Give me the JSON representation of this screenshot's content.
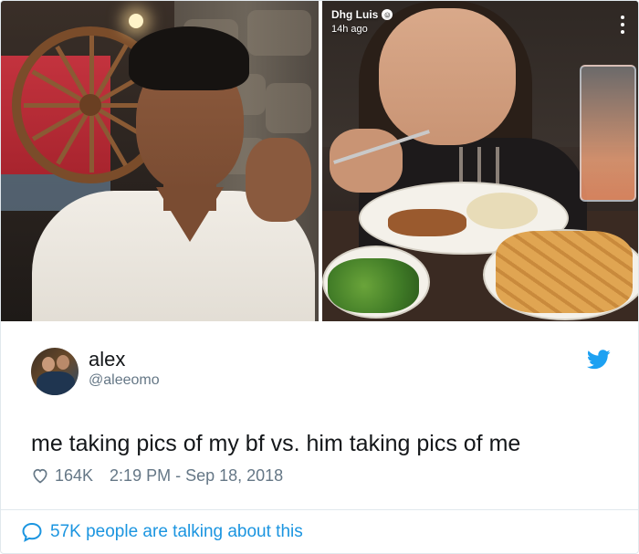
{
  "photos": {
    "left": {
      "alt": ""
    },
    "right": {
      "snap_username": "Dhg Luis",
      "snap_time": "14h ago"
    }
  },
  "tweet": {
    "display_name": "alex",
    "handle": "@aleeomo",
    "text": "me taking pics of my bf vs. him taking pics of me",
    "like_count": "164K",
    "timestamp": "2:19 PM - Sep 18, 2018",
    "conversation": "57K people are talking about this"
  },
  "colors": {
    "twitter_blue": "#1da1f2",
    "link_blue": "#1b95e0",
    "meta_gray": "#657786"
  },
  "icons": {
    "brand": "twitter-bird-icon",
    "like": "heart-outline-icon",
    "reply": "speech-bubble-icon",
    "menu": "vertical-dots-icon"
  }
}
